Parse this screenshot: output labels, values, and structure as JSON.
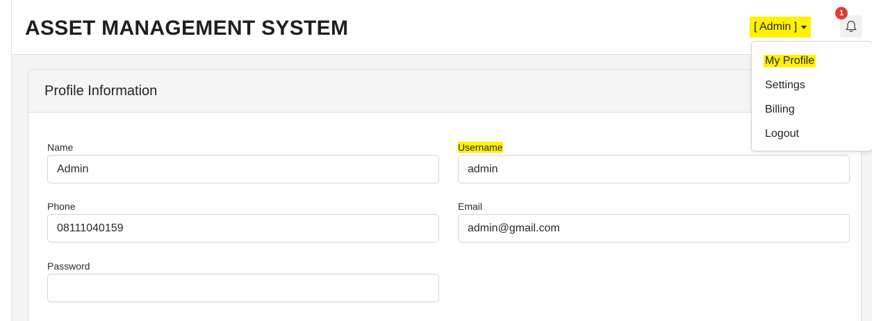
{
  "header": {
    "app_title": "ASSET MANAGEMENT SYSTEM",
    "user_menu_label": "[ Admin ]",
    "notification_count": "1"
  },
  "user_menu": {
    "items": [
      {
        "label": "My Profile",
        "highlighted": true
      },
      {
        "label": "Settings"
      },
      {
        "label": "Billing"
      },
      {
        "label": "Logout"
      }
    ]
  },
  "profile": {
    "card_title": "Profile Information",
    "fields": {
      "name": {
        "label": "Name",
        "value": "Admin"
      },
      "username": {
        "label": "Username",
        "value": "admin"
      },
      "phone": {
        "label": "Phone",
        "value": "08111040159"
      },
      "email": {
        "label": "Email",
        "value": "admin@gmail.com"
      },
      "password": {
        "label": "Password",
        "value": ""
      }
    }
  },
  "colors": {
    "highlight": "#fff200",
    "badge": "#e53935",
    "card_header_bg": "#f5f5f5"
  },
  "icons": {
    "notifications": "bell-icon",
    "user_menu_caret": "caret-down-icon"
  }
}
